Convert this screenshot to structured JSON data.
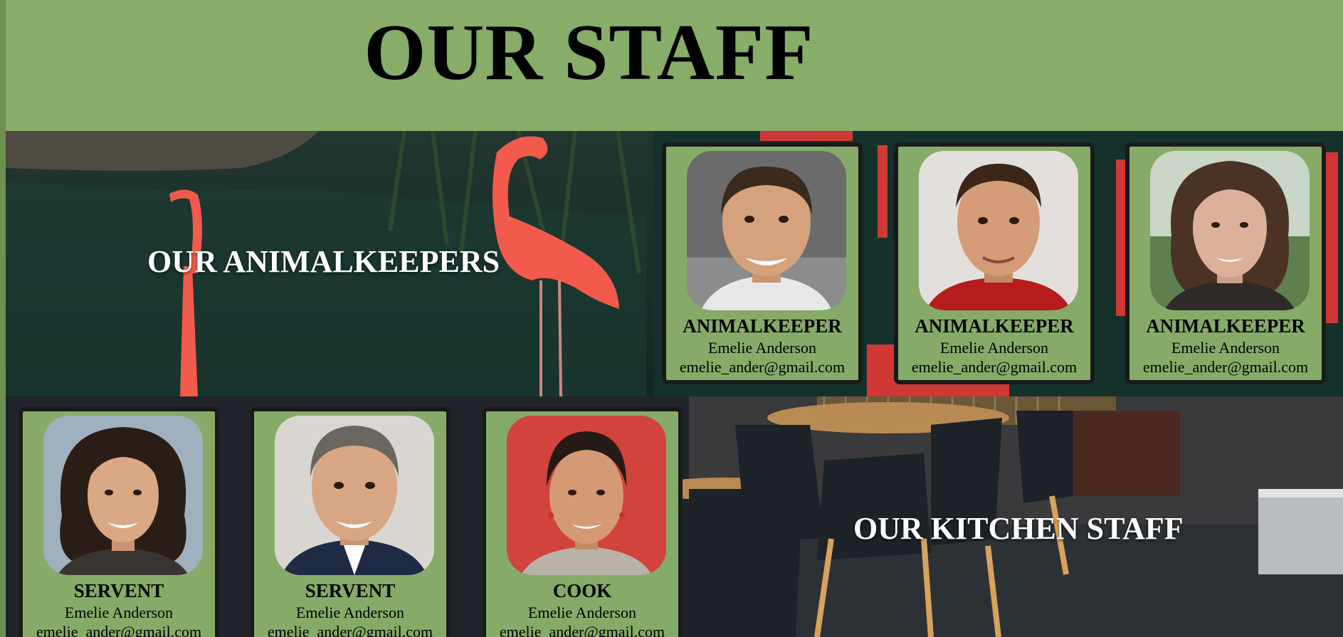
{
  "page": {
    "title": "OUR STAFF"
  },
  "sections": {
    "animalkeepers": {
      "title": "OUR ANIMALKEEPERS",
      "cards": [
        {
          "role": "ANIMALKEEPER",
          "name": "Emelie Anderson",
          "email": "emelie_ander@gmail.com"
        },
        {
          "role": "ANIMALKEEPER",
          "name": "Emelie Anderson",
          "email": "emelie_ander@gmail.com"
        },
        {
          "role": "ANIMALKEEPER",
          "name": "Emelie Anderson",
          "email": "emelie_ander@gmail.com"
        }
      ]
    },
    "kitchen": {
      "title": "OUR KITCHEN STAFF",
      "cards": [
        {
          "role": "SERVENT",
          "name": "Emelie Anderson",
          "email": "emelie_ander@gmail.com"
        },
        {
          "role": "SERVENT",
          "name": "Emelie Anderson",
          "email": "emelie_ander@gmail.com"
        },
        {
          "role": "COOK",
          "name": "Emelie Anderson",
          "email": "emelie_ander@gmail.com"
        }
      ]
    }
  },
  "colors": {
    "page_background": "#87ad69",
    "card_background": "#86ab68",
    "card_border": "#1a1a1a"
  }
}
